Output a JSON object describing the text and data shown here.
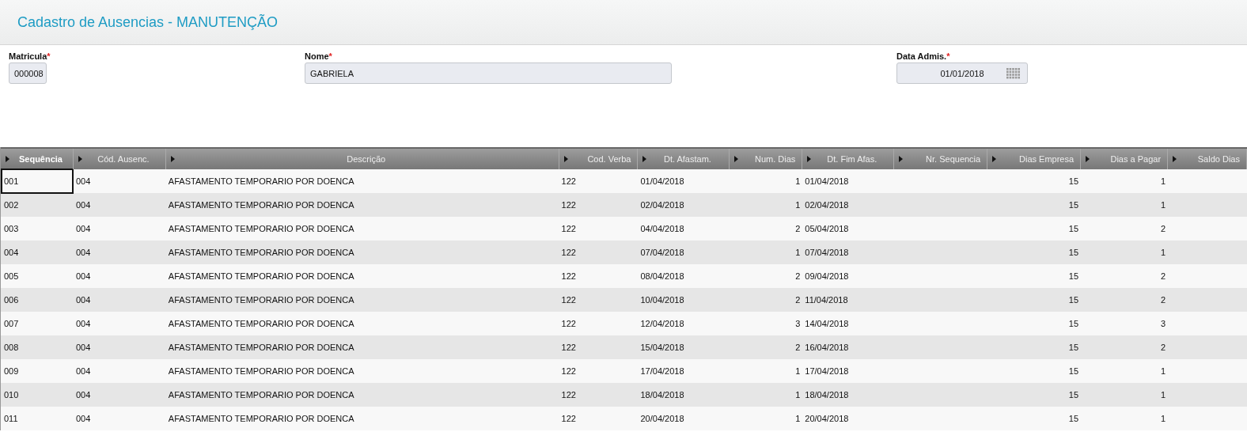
{
  "header": {
    "title": "Cadastro de Ausencias - MANUTENÇÃO"
  },
  "fields": [
    {
      "label": "Matricula",
      "required_mark": "*",
      "value": "000008",
      "kind": "short"
    },
    {
      "label": "Nome",
      "required_mark": "*",
      "value": "GABRIELA",
      "kind": "wide"
    },
    {
      "label": "Data Admis.",
      "required_mark": "*",
      "value": "01/01/2018",
      "kind": "date"
    }
  ],
  "table": {
    "columns": [
      {
        "label": "Sequência"
      },
      {
        "label": "Cód. Ausenc."
      },
      {
        "label": "Descrição"
      },
      {
        "label": "Cod. Verba"
      },
      {
        "label": "Dt. Afastam."
      },
      {
        "label": "Num. Dias"
      },
      {
        "label": "Dt. Fim Afas."
      },
      {
        "label": "Nr. Sequencia"
      },
      {
        "label": "Dias Empresa"
      },
      {
        "label": "Dias a Pagar"
      },
      {
        "label": "Saldo Dias"
      }
    ],
    "rows": [
      {
        "selected": true,
        "sequencia": "001",
        "cod_ausenc": "004",
        "descricao": "AFASTAMENTO TEMPORARIO POR DOENCA",
        "cod_verba": "122",
        "dt_afastam": "01/04/2018",
        "num_dias": "1",
        "dt_fim": "01/04/2018",
        "dias_empresa": "15",
        "dias_pagar": "1"
      },
      {
        "selected": false,
        "sequencia": "002",
        "cod_ausenc": "004",
        "descricao": "AFASTAMENTO TEMPORARIO POR DOENCA",
        "cod_verba": "122",
        "dt_afastam": "02/04/2018",
        "num_dias": "1",
        "dt_fim": "02/04/2018",
        "dias_empresa": "15",
        "dias_pagar": "1"
      },
      {
        "selected": false,
        "sequencia": "003",
        "cod_ausenc": "004",
        "descricao": "AFASTAMENTO TEMPORARIO POR DOENCA",
        "cod_verba": "122",
        "dt_afastam": "04/04/2018",
        "num_dias": "2",
        "dt_fim": "05/04/2018",
        "dias_empresa": "15",
        "dias_pagar": "2"
      },
      {
        "selected": false,
        "sequencia": "004",
        "cod_ausenc": "004",
        "descricao": "AFASTAMENTO TEMPORARIO POR DOENCA",
        "cod_verba": "122",
        "dt_afastam": "07/04/2018",
        "num_dias": "1",
        "dt_fim": "07/04/2018",
        "dias_empresa": "15",
        "dias_pagar": "1"
      },
      {
        "selected": false,
        "sequencia": "005",
        "cod_ausenc": "004",
        "descricao": "AFASTAMENTO TEMPORARIO POR DOENCA",
        "cod_verba": "122",
        "dt_afastam": "08/04/2018",
        "num_dias": "2",
        "dt_fim": "09/04/2018",
        "dias_empresa": "15",
        "dias_pagar": "2"
      },
      {
        "selected": false,
        "sequencia": "006",
        "cod_ausenc": "004",
        "descricao": "AFASTAMENTO TEMPORARIO POR DOENCA",
        "cod_verba": "122",
        "dt_afastam": "10/04/2018",
        "num_dias": "2",
        "dt_fim": "11/04/2018",
        "dias_empresa": "15",
        "dias_pagar": "2"
      },
      {
        "selected": false,
        "sequencia": "007",
        "cod_ausenc": "004",
        "descricao": "AFASTAMENTO TEMPORARIO POR DOENCA",
        "cod_verba": "122",
        "dt_afastam": "12/04/2018",
        "num_dias": "3",
        "dt_fim": "14/04/2018",
        "dias_empresa": "15",
        "dias_pagar": "3"
      },
      {
        "selected": false,
        "sequencia": "008",
        "cod_ausenc": "004",
        "descricao": "AFASTAMENTO TEMPORARIO POR DOENCA",
        "cod_verba": "122",
        "dt_afastam": "15/04/2018",
        "num_dias": "2",
        "dt_fim": "16/04/2018",
        "dias_empresa": "15",
        "dias_pagar": "2"
      },
      {
        "selected": false,
        "sequencia": "009",
        "cod_ausenc": "004",
        "descricao": "AFASTAMENTO TEMPORARIO POR DOENCA",
        "cod_verba": "122",
        "dt_afastam": "17/04/2018",
        "num_dias": "1",
        "dt_fim": "17/04/2018",
        "dias_empresa": "15",
        "dias_pagar": "1"
      },
      {
        "selected": false,
        "sequencia": "010",
        "cod_ausenc": "004",
        "descricao": "AFASTAMENTO TEMPORARIO POR DOENCA",
        "cod_verba": "122",
        "dt_afastam": "18/04/2018",
        "num_dias": "1",
        "dt_fim": "18/04/2018",
        "dias_empresa": "15",
        "dias_pagar": "1"
      },
      {
        "selected": false,
        "sequencia": "011",
        "cod_ausenc": "004",
        "descricao": "AFASTAMENTO TEMPORARIO POR DOENCA",
        "cod_verba": "122",
        "dt_afastam": "20/04/2018",
        "num_dias": "1",
        "dt_fim": "20/04/2018",
        "dias_empresa": "15",
        "dias_pagar": "1"
      }
    ]
  }
}
